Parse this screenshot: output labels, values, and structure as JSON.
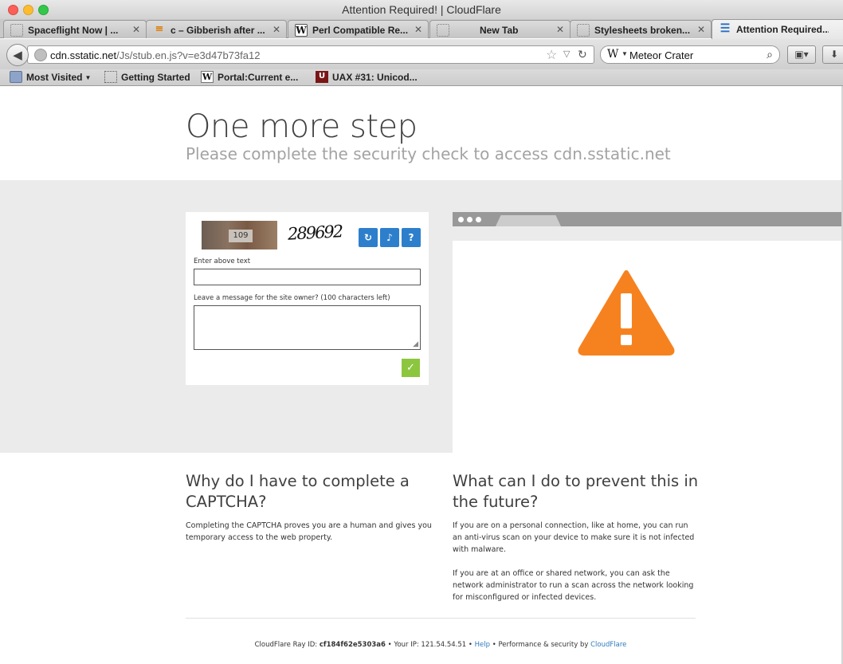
{
  "window": {
    "title": "Attention Required! | CloudFlare"
  },
  "tabs": [
    {
      "label": "Spaceflight Now | ..."
    },
    {
      "label": "c – Gibberish after ..."
    },
    {
      "label": "Perl Compatible Re..."
    },
    {
      "label": "New Tab"
    },
    {
      "label": "Stylesheets broken..."
    },
    {
      "label": "Attention Required..."
    }
  ],
  "toolbar": {
    "url_domain": "cdn.sstatic.net",
    "url_path": "/Js/stub.en.js?v=e3d47b73fa12",
    "search_query": "Meteor Crater"
  },
  "bookmarks": [
    {
      "label": "Most Visited"
    },
    {
      "label": "Getting Started"
    },
    {
      "label": "Portal:Current e..."
    },
    {
      "label": "UAX #31: Unicod..."
    }
  ],
  "page": {
    "heading": "One more step",
    "subheading": "Please complete the security check to access cdn.sstatic.net"
  },
  "captcha": {
    "image_plate_text": "109",
    "word_text": "289692",
    "enter_label": "Enter above text",
    "message_label": "Leave a message for the site owner? (100 characters left)"
  },
  "why": {
    "title": "Why do I have to complete a CAPTCHA?",
    "text": "Completing the CAPTCHA proves you are a human and gives you temporary access to the web property."
  },
  "prevent": {
    "title": "What can I do to prevent this in the future?",
    "text1": "If you are on a personal connection, like at home, you can run an anti-virus scan on your device to make sure it is not infected with malware.",
    "text2": "If you are at an office or shared network, you can ask the network administrator to run a scan across the network looking for misconfigured or infected devices."
  },
  "footer": {
    "ray_label": "CloudFlare Ray ID:",
    "ray_id": "cf184f62e5303a6",
    "ip_label": "Your IP:",
    "ip": "121.54.54.51",
    "help": "Help",
    "perf": "Performance & security by",
    "cf_link": "CloudFlare",
    "sep": "•"
  },
  "colors": {
    "warning": "#f6821f",
    "captcha_button": "#2d7fcc",
    "submit": "#8cc63f",
    "link": "#2f7bbf"
  },
  "icons": [
    "back-arrow-icon",
    "globe-icon",
    "star-icon",
    "reload-icon",
    "search-icon",
    "refresh-icon",
    "audio-icon",
    "help-icon",
    "checkmark-icon",
    "warning-icon"
  ]
}
